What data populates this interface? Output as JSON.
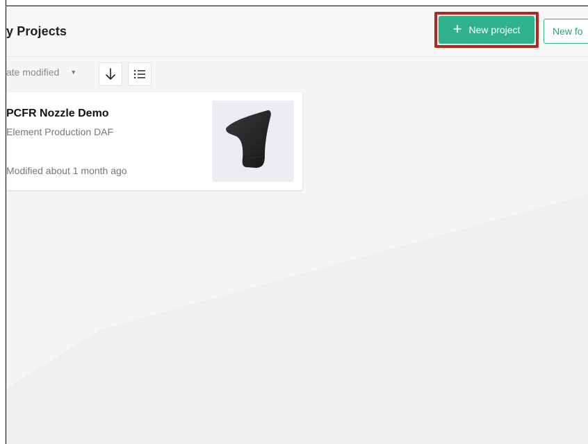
{
  "header": {
    "title": "y Projects",
    "new_project_label": "New project",
    "new_folder_label": "New fo"
  },
  "toolbar": {
    "sort_label": "ate modified",
    "sort_direction_icon": "arrow-down-icon",
    "view_toggle_icon": "list-view-icon"
  },
  "projects": [
    {
      "name": "PCFR Nozzle Demo",
      "subtitle": "Element Production DAF",
      "modified": "Modified about 1 month ago",
      "thumbnail_icon": "nozzle-3d-model"
    }
  ],
  "colors": {
    "accent": "#2fb38a",
    "highlight": "#b3261e",
    "background": "#f5f5f5"
  }
}
